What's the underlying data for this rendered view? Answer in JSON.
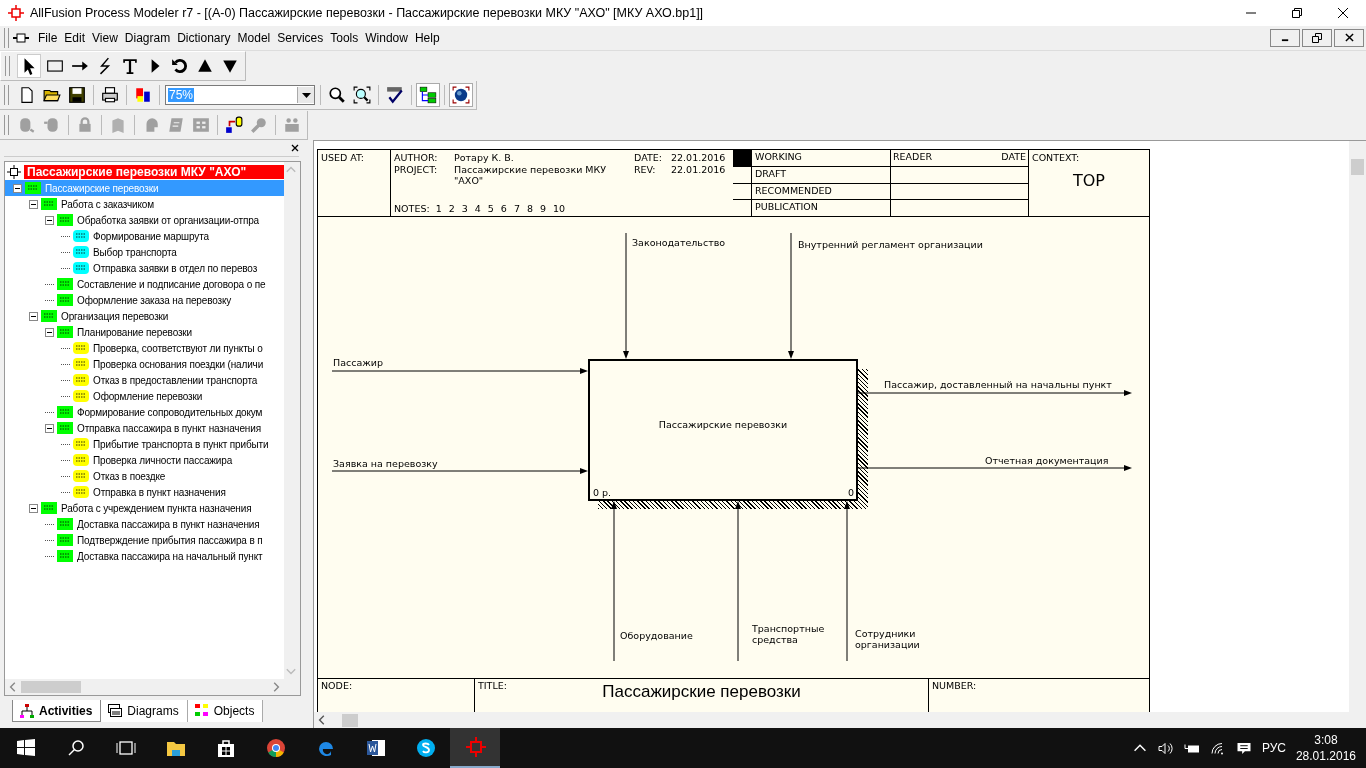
{
  "window": {
    "title": "AllFusion Process Modeler r7 - [(A-0) Пассажирские перевозки - Пассажирские перевозки МКУ \"АХО\"  [МКУ АХО.bp1]]"
  },
  "menu": [
    "File",
    "Edit",
    "View",
    "Diagram",
    "Dictionary",
    "Model",
    "Services",
    "Tools",
    "Window",
    "Help"
  ],
  "zoom": {
    "value": "75%"
  },
  "model_tree": {
    "model": "Пассажирские перевозки МКУ \"АХО\"",
    "items": [
      {
        "label": "Пассажирские перевозки",
        "color": "#00ff00",
        "selected": true,
        "expanded": true,
        "children": [
          {
            "label": "Работа с заказчиком",
            "color": "#00ff00",
            "selected": false,
            "expanded": true,
            "children": [
              {
                "label": "Обработка заявки  от организации-отпра",
                "color": "#00ff00",
                "selected": false,
                "expanded": true,
                "children": [
                  {
                    "label": "Формирование маршрута",
                    "color": "#00ffff",
                    "selected": false
                  },
                  {
                    "label": "Выбор транспорта",
                    "color": "#00ffff",
                    "selected": false
                  },
                  {
                    "label": "Отправка заявки в отдел  по перевоз",
                    "color": "#00ffff",
                    "selected": false
                  }
                ]
              },
              {
                "label": "Составление и подписание договора о пе",
                "color": "#00ff00",
                "selected": false
              },
              {
                "label": "Оформление заказа  на перевозку",
                "color": "#00ff00",
                "selected": false
              }
            ]
          },
          {
            "label": "Организация перевозки",
            "color": "#00ff00",
            "selected": false,
            "expanded": true,
            "children": [
              {
                "label": "Планирование перевозки",
                "color": "#00ff00",
                "selected": false,
                "expanded": true,
                "children": [
                  {
                    "label": "Проверка, соответствуют ли пункты о",
                    "color": "#ffff00",
                    "selected": false
                  },
                  {
                    "label": "Проверка основания поездки (наличи",
                    "color": "#ffff00",
                    "selected": false
                  },
                  {
                    "label": "Отказ в предоставлении транспорта",
                    "color": "#ffff00",
                    "selected": false
                  },
                  {
                    "label": "Оформление перевозки",
                    "color": "#ffff00",
                    "selected": false
                  }
                ]
              },
              {
                "label": "Формирование сопроводительных докум",
                "color": "#00ff00",
                "selected": false
              },
              {
                "label": "Отправка пассажира  в пункт назначения",
                "color": "#00ff00",
                "selected": false,
                "expanded": true,
                "children": [
                  {
                    "label": "Прибытие транспорта в пункт прибыти",
                    "color": "#ffff00",
                    "selected": false
                  },
                  {
                    "label": "Проверка личности пассажира",
                    "color": "#ffff00",
                    "selected": false
                  },
                  {
                    "label": "Отказ в поездке",
                    "color": "#ffff00",
                    "selected": false
                  },
                  {
                    "label": "Отправка в пункт  назначения",
                    "color": "#ffff00",
                    "selected": false
                  }
                ]
              }
            ]
          },
          {
            "label": "Работа с учреждением пункта назначения",
            "color": "#00ff00",
            "selected": false,
            "expanded": true,
            "children": [
              {
                "label": "Доставка пассажира в пункт назначения",
                "color": "#00ff00",
                "selected": false
              },
              {
                "label": "Подтверждение прибытия пассажира в п",
                "color": "#00ff00",
                "selected": false
              },
              {
                "label": "Доставка пассажира на начальный пункт",
                "color": "#00ff00",
                "selected": false
              }
            ]
          }
        ]
      }
    ]
  },
  "panel_tabs": [
    {
      "label": "Activities",
      "selected": true
    },
    {
      "label": "Diagrams",
      "selected": false
    },
    {
      "label": "Objects",
      "selected": false
    }
  ],
  "diagram": {
    "header": {
      "used_at": "USED AT:",
      "author_label": "AUTHOR:",
      "author": "Ротару К. В.",
      "date_label": "DATE:",
      "date": "22.01.2016",
      "project_label": "PROJECT:",
      "project": "Пассажирские перевозки МКУ \"АХО\"",
      "rev_label": "REV:",
      "rev": "22.01.2016",
      "notes_label": "NOTES:",
      "notes": [
        "1",
        "2",
        "3",
        "4",
        "5",
        "6",
        "7",
        "8",
        "9",
        "10"
      ],
      "statuses": [
        {
          "label": "WORKING",
          "selected": true
        },
        {
          "label": "DRAFT",
          "selected": false
        },
        {
          "label": "RECOMMENDED",
          "selected": false
        },
        {
          "label": "PUBLICATION",
          "selected": false
        }
      ],
      "reader": "READER",
      "reader_date": "DATE",
      "context_label": "CONTEXT:",
      "context": "TOP"
    },
    "activity": {
      "name": "Пассажирские перевозки",
      "cost": "0 р.",
      "number": "0"
    },
    "arrows": [
      {
        "kind": "control",
        "label": "Законодательство"
      },
      {
        "kind": "control",
        "label": "Внутренний регламент организации"
      },
      {
        "kind": "input",
        "label": "Пассажир"
      },
      {
        "kind": "input",
        "label": "Заявка на перевозку"
      },
      {
        "kind": "output",
        "label": "Пассажир, доставленный на начальны пункт"
      },
      {
        "kind": "output",
        "label": "Отчетная документация"
      },
      {
        "kind": "mechanism",
        "label": "Оборудование"
      },
      {
        "kind": "mechanism",
        "label": "Транспортные средства"
      },
      {
        "kind": "mechanism",
        "label": "Сотрудники организации"
      }
    ],
    "footer": {
      "node_label": "NODE:",
      "title_label": "TITLE:",
      "title": "Пассажирские перевозки",
      "number_label": "NUMBER:"
    }
  },
  "taskbar": {
    "language": "РУС",
    "time": "3:08",
    "date": "28.01.2016"
  }
}
